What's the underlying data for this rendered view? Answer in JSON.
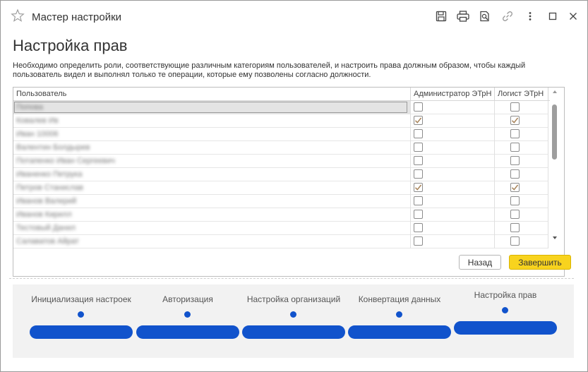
{
  "window": {
    "title": "Мастер настройки"
  },
  "page": {
    "title": "Настройка прав",
    "description": "Необходимо определить роли, соответствующие различным категориям пользователей, и настроить права должным образом, чтобы каждый пользователь видел и выполнял только те операции, которые ему позволены согласно должности."
  },
  "table": {
    "columns": [
      "Пользователь",
      "Администратор ЭТрН",
      "Логист ЭТрН"
    ],
    "rows": [
      {
        "user": "Попова",
        "admin": false,
        "logist": false,
        "selected": true
      },
      {
        "user": "Ковалев Ив",
        "admin": true,
        "logist": true,
        "selected": false
      },
      {
        "user": "Иван 10006",
        "admin": false,
        "logist": false,
        "selected": false
      },
      {
        "user": "Валентин Болдырев",
        "admin": false,
        "logist": false,
        "selected": false
      },
      {
        "user": "Потапенко Иван Сергеевич",
        "admin": false,
        "logist": false,
        "selected": false
      },
      {
        "user": "Иваненко Петрука",
        "admin": false,
        "logist": false,
        "selected": false
      },
      {
        "user": "Петров Станислав",
        "admin": true,
        "logist": true,
        "selected": false
      },
      {
        "user": "Иванов Валерий",
        "admin": false,
        "logist": false,
        "selected": false
      },
      {
        "user": "Иванов Кирилл",
        "admin": false,
        "logist": false,
        "selected": false
      },
      {
        "user": "Тестовый Данил",
        "admin": false,
        "logist": false,
        "selected": false
      },
      {
        "user": "Салаватов Айрат",
        "admin": false,
        "logist": false,
        "selected": false
      }
    ]
  },
  "buttons": {
    "back": "Назад",
    "finish": "Завершить"
  },
  "steps": [
    {
      "label": "Инициализация настроек",
      "active": false
    },
    {
      "label": "Авторизация",
      "active": false
    },
    {
      "label": "Настройка организаций",
      "active": false
    },
    {
      "label": "Конвертация данных",
      "active": false
    },
    {
      "label": "Настройка прав",
      "active": true
    }
  ],
  "colors": {
    "accent": "#1153cc",
    "finish_button": "#f8d31e",
    "checkmark": "#a8845a"
  },
  "icons": {
    "favorite": "star-icon",
    "save": "save-icon",
    "print": "print-icon",
    "preview": "preview-icon",
    "link": "link-icon",
    "more": "more-icon",
    "maximize": "maximize-icon",
    "close": "close-icon"
  }
}
